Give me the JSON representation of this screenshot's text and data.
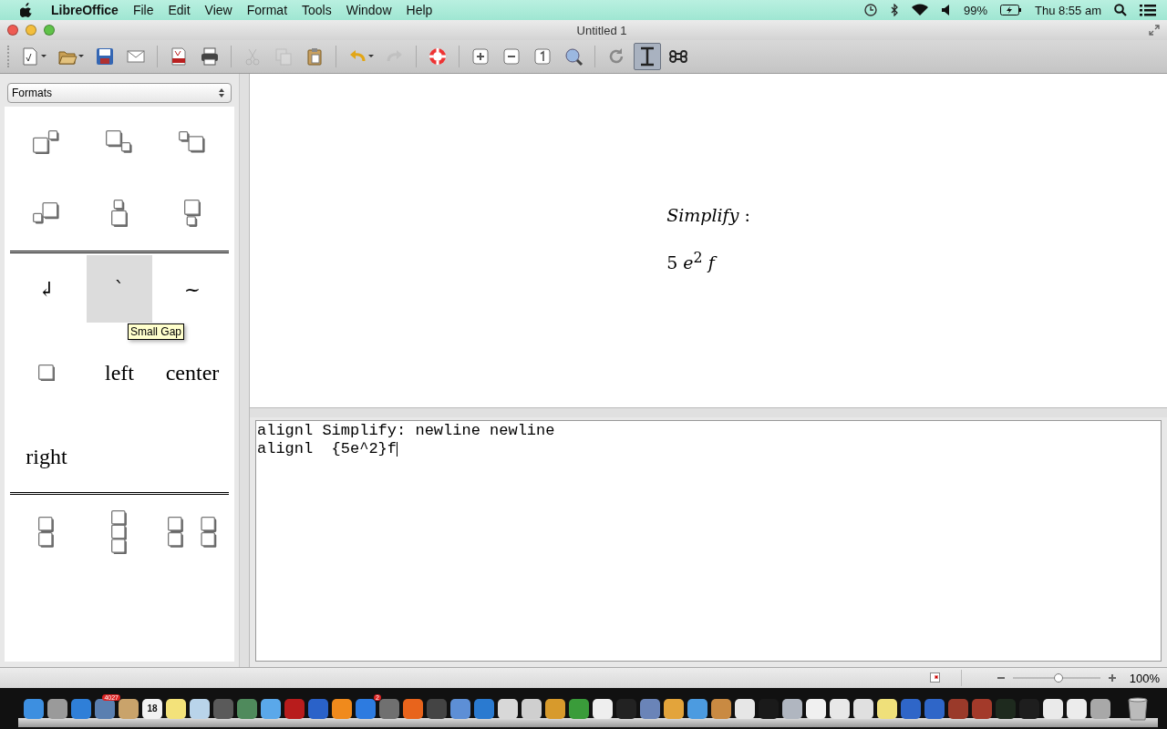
{
  "menu_bar": {
    "app": "LibreOffice",
    "menus": [
      "File",
      "Edit",
      "View",
      "Format",
      "Tools",
      "Window",
      "Help"
    ],
    "battery": "99%",
    "clock": "Thu 8:55 am"
  },
  "window": {
    "title": "Untitled 1"
  },
  "toolbar": [
    {
      "kind": "new",
      "disabled": false,
      "dropdown": true,
      "selected": false
    },
    {
      "kind": "open",
      "disabled": false,
      "dropdown": true,
      "selected": false
    },
    {
      "kind": "save",
      "disabled": false,
      "dropdown": false,
      "selected": false
    },
    {
      "kind": "mail",
      "disabled": false,
      "dropdown": false,
      "selected": false
    },
    {
      "kind": "sep"
    },
    {
      "kind": "pdf",
      "disabled": false,
      "dropdown": false,
      "selected": false
    },
    {
      "kind": "print",
      "disabled": false,
      "dropdown": false,
      "selected": false
    },
    {
      "kind": "sep"
    },
    {
      "kind": "cut",
      "disabled": true,
      "dropdown": false,
      "selected": false
    },
    {
      "kind": "copy",
      "disabled": true,
      "dropdown": false,
      "selected": false
    },
    {
      "kind": "paste",
      "disabled": false,
      "dropdown": false,
      "selected": false
    },
    {
      "kind": "sep"
    },
    {
      "kind": "undo",
      "disabled": false,
      "dropdown": true,
      "selected": false
    },
    {
      "kind": "redo",
      "disabled": true,
      "dropdown": false,
      "selected": false
    },
    {
      "kind": "sep"
    },
    {
      "kind": "help",
      "disabled": false,
      "dropdown": false,
      "selected": false
    },
    {
      "kind": "sep"
    },
    {
      "kind": "zoomin",
      "disabled": false,
      "dropdown": false,
      "selected": false
    },
    {
      "kind": "zoomout",
      "disabled": false,
      "dropdown": false,
      "selected": false
    },
    {
      "kind": "zoom100",
      "disabled": false,
      "dropdown": false,
      "selected": false
    },
    {
      "kind": "zoomall",
      "disabled": false,
      "dropdown": false,
      "selected": false
    },
    {
      "kind": "sep"
    },
    {
      "kind": "update",
      "disabled": false,
      "dropdown": false,
      "selected": false
    },
    {
      "kind": "cursor",
      "disabled": false,
      "dropdown": false,
      "selected": true
    },
    {
      "kind": "symbols",
      "disabled": false,
      "dropdown": false,
      "selected": false
    }
  ],
  "sidebar": {
    "dropdown": "Formats",
    "groups": [
      [
        {
          "kind": "rsup",
          "selected": false
        },
        {
          "kind": "rsub",
          "selected": false
        },
        {
          "kind": "lsup",
          "selected": false
        },
        {
          "kind": "lsub",
          "selected": false
        },
        {
          "kind": "csup",
          "selected": false
        },
        {
          "kind": "csub",
          "selected": false
        }
      ],
      [
        {
          "kind": "glyph",
          "label": "↲",
          "selected": false
        },
        {
          "kind": "glyph",
          "label": "`",
          "selected": true
        },
        {
          "kind": "glyph",
          "label": "~",
          "selected": false
        },
        {
          "kind": "box",
          "selected": false
        },
        {
          "kind": "word",
          "label": "left",
          "selected": false
        },
        {
          "kind": "word",
          "label": "center",
          "selected": false
        },
        {
          "kind": "word",
          "label": "right",
          "selected": false
        }
      ],
      [
        {
          "kind": "stack2",
          "selected": false
        },
        {
          "kind": "stack3",
          "selected": false
        },
        {
          "kind": "matrix",
          "selected": false
        }
      ]
    ],
    "tooltip": "Small Gap"
  },
  "document": {
    "lines": [
      "*Simplify* :",
      "5 *e*$^{2}$ *f*"
    ]
  },
  "editor": {
    "lines": [
      "alignl Simplify: newline newline",
      "alignl  {5e^2}f"
    ]
  },
  "status_bar": {
    "zoom": {
      "level": 0.52
    },
    "zoom_reading": "100%"
  },
  "dock": [
    {
      "color": "#3d8fe0"
    },
    {
      "color": "#9a9a9a"
    },
    {
      "color": "#2f7fd8"
    },
    {
      "color": "#5a7fb0",
      "badge": "4027"
    },
    {
      "color": "#c9a36b"
    },
    {
      "color": "#f2f2f2",
      "text": "18"
    },
    {
      "color": "#f3e27a"
    },
    {
      "color": "#b9d4ea"
    },
    {
      "color": "#5a5a5a"
    },
    {
      "color": "#4f8a5c"
    },
    {
      "color": "#5aa8ea"
    },
    {
      "color": "#b81c1c"
    },
    {
      "color": "#2a62c9"
    },
    {
      "color": "#f08a1c"
    },
    {
      "color": "#2d7be0",
      "badge": "2"
    },
    {
      "color": "#707070"
    },
    {
      "color": "#e8641c"
    },
    {
      "color": "#444444"
    },
    {
      "color": "#5d8fd6"
    },
    {
      "color": "#2a7ad0"
    },
    {
      "color": "#d8d8d8"
    },
    {
      "color": "#cfcfcf"
    },
    {
      "color": "#d79a2c"
    },
    {
      "color": "#3a9c3a"
    },
    {
      "color": "#eeeeee"
    },
    {
      "color": "#222222"
    },
    {
      "color": "#6a84b8"
    },
    {
      "color": "#e3a43b"
    },
    {
      "color": "#4c9be0"
    },
    {
      "color": "#c98a42"
    },
    {
      "color": "#e6e6e6"
    },
    {
      "color": "#1a1a1a"
    },
    {
      "color": "#b0b6c0"
    },
    {
      "color": "#f0f0f0"
    },
    {
      "color": "#e8e8e8"
    },
    {
      "color": "#e0e0e0"
    },
    {
      "color": "#efe07a"
    },
    {
      "color": "#2f66c8"
    },
    {
      "color": "#2f66c8"
    },
    {
      "color": "#9a3a2a"
    },
    {
      "color": "#a33a2a"
    },
    {
      "color": "#1e2a1e"
    },
    {
      "color": "#1e1e1e"
    },
    {
      "color": "#eaeaea"
    },
    {
      "color": "#ececec"
    },
    {
      "color": "#a8a8a8"
    }
  ]
}
